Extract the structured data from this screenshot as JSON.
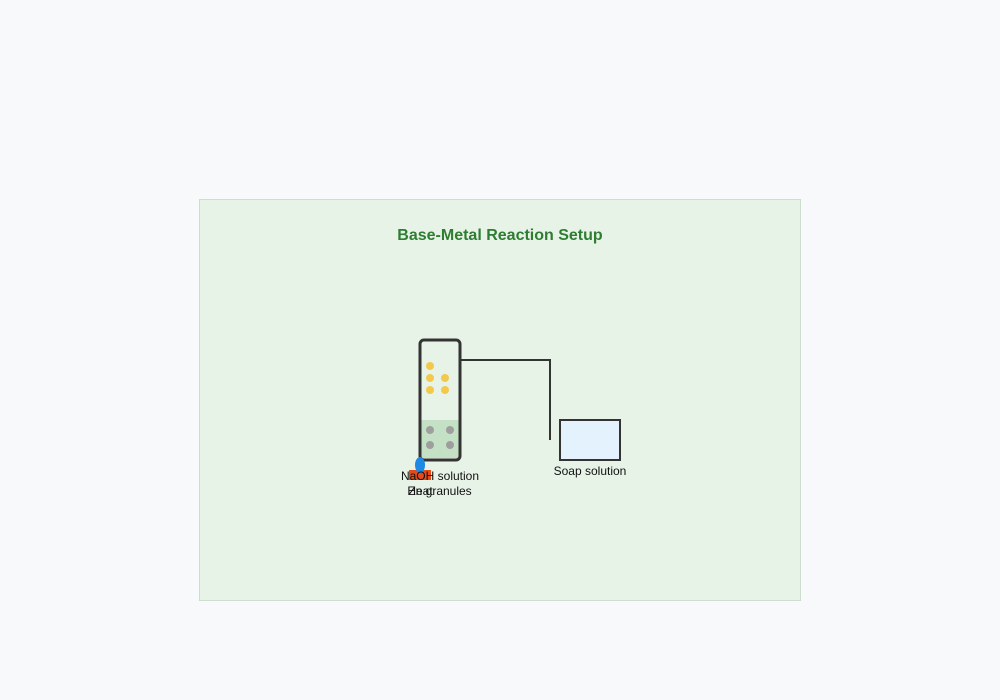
{
  "diagram": {
    "title": "Base-Metal Reaction Setup",
    "labels": {
      "naoh": "NaOH solution",
      "zinc": "Zn granules",
      "heat": "Heat",
      "soap": "Soap solution"
    },
    "colors": {
      "page_background": "#f7f9fb",
      "panel_background": "#e8f3e8",
      "title": "#2e7d32",
      "tube_outline": "#333333",
      "solution_fill": "#c5e1c5",
      "zinc_granule": "#9e9e9e",
      "gas_bubble": "#f2c94c",
      "flame": "#1e88e5",
      "burner": "#e64a19",
      "soap_fill": "#e3f2fd"
    },
    "icons": [
      "test-tube-icon",
      "zinc-granule-icon",
      "gas-bubble-icon",
      "flame-icon",
      "burner-icon",
      "delivery-tube-icon",
      "soap-trough-icon"
    ]
  }
}
